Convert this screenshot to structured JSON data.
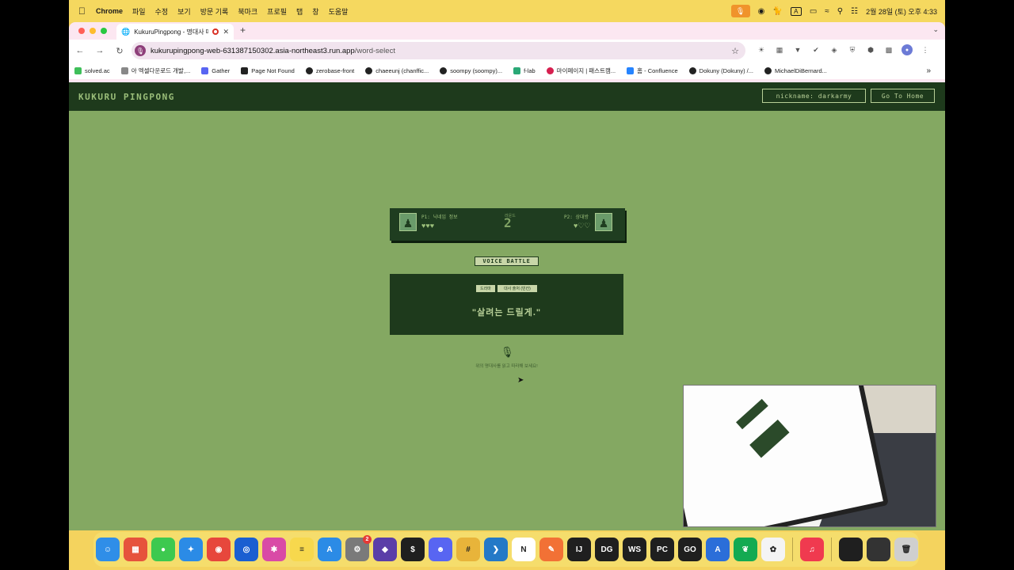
{
  "menubar": {
    "app_name": "Chrome",
    "menus": [
      "파일",
      "수정",
      "보기",
      "방문 기록",
      "북마크",
      "프로필",
      "탭",
      "창",
      "도움말"
    ],
    "input_indicator": "A",
    "clock": "2월 28일 (토) 오후 4:33"
  },
  "browser": {
    "tab_title": "KukuruPingpong - 명대사 따라하기",
    "url_host": "kukurupingpong-web-631387150302.asia-northeast3.run.app",
    "url_path": "/word-select",
    "bookmarks": [
      {
        "label": "solved.ac",
        "color": "#3fbf5a"
      },
      {
        "label": "아 엑셀다운로드 개발,...",
        "color": "#888888"
      },
      {
        "label": "Gather",
        "color": "#5865f2"
      },
      {
        "label": "Page Not Found",
        "color": "#222222"
      },
      {
        "label": "zerobase-front",
        "color": "#222222"
      },
      {
        "label": "chaeeunj (chanffic...",
        "color": "#222222"
      },
      {
        "label": "soompy (soompy)...",
        "color": "#222222"
      },
      {
        "label": "f-lab",
        "color": "#2aa876"
      },
      {
        "label": "마이페이지 | 패스트캠...",
        "color": "#d61f4f"
      },
      {
        "label": "홈 - Confluence",
        "color": "#2684ff"
      },
      {
        "label": "Dokuny (Dokuny) /...",
        "color": "#222222"
      },
      {
        "label": "MichaelDiBernard...",
        "color": "#222222"
      }
    ]
  },
  "site": {
    "logo": "KUKURU PINGPONG",
    "nickname_button": "nickname: darkarmy",
    "home_button": "Go To Home"
  },
  "game": {
    "p1": {
      "name": "P1: 닉네임 정보",
      "hearts": "♥♥♥",
      "lives": 3,
      "max_lives": 3
    },
    "p2": {
      "name": "P2: 상대방",
      "hearts": "♥♡♡",
      "lives": 1,
      "max_lives": 3
    },
    "round_label": "라운드",
    "round": "2",
    "mode": "VOICE BATTLE",
    "chip_1": "드라마",
    "chip_2": "대사 출처 (빈칸)",
    "quote": "\"살려는 드릴게.\"",
    "hint": "위의 명대사를 읽고 따라해 보세요!"
  },
  "colors": {
    "page_bg": "#84a862",
    "dark_green": "#1e3a1c",
    "light_green": "#b7cf97",
    "menubar_bg": "#f5d85f"
  },
  "dock": {
    "apps": [
      {
        "name": "Finder",
        "icon": "finder-icon",
        "glyph": "☺",
        "color": "#2f8ee8"
      },
      {
        "name": "Launchpad",
        "icon": "launchpad-icon",
        "glyph": "▦",
        "color": "#e6533c"
      },
      {
        "name": "Messages",
        "icon": "messages-icon",
        "glyph": "●",
        "color": "#3dc94f"
      },
      {
        "name": "Safari",
        "icon": "safari-icon",
        "glyph": "✦",
        "color": "#2b8be6"
      },
      {
        "name": "Chrome",
        "icon": "chrome-icon",
        "glyph": "◉",
        "color": "#e7473c"
      },
      {
        "name": "Firefox",
        "icon": "firefox-icon",
        "glyph": "◎",
        "color": "#1a5fd1"
      },
      {
        "name": "Affinity",
        "icon": "affinity-icon",
        "glyph": "✱",
        "color": "#d94aa6"
      },
      {
        "name": "Notes",
        "icon": "notes-icon",
        "glyph": "≡",
        "color": "#f7d84d"
      },
      {
        "name": "App Store",
        "icon": "app-store-icon",
        "glyph": "A",
        "color": "#2b8be6"
      },
      {
        "name": "System Settings",
        "icon": "settings-icon",
        "glyph": "⚙",
        "color": "#7a7a7a",
        "badge": "2"
      },
      {
        "name": "Obsidian",
        "icon": "obsidian-icon",
        "glyph": "◆",
        "color": "#5a3ea8"
      },
      {
        "name": "Terminal",
        "icon": "terminal-icon",
        "glyph": "$",
        "color": "#1f1f1f"
      },
      {
        "name": "Discord",
        "icon": "discord-icon",
        "glyph": "☻",
        "color": "#5865f2"
      },
      {
        "name": "Slack",
        "icon": "slack-icon",
        "glyph": "#",
        "color": "#e8b43a"
      },
      {
        "name": "VS Code",
        "icon": "vscode-icon",
        "glyph": "❯",
        "color": "#2479c7"
      },
      {
        "name": "Notion",
        "icon": "notion-icon",
        "glyph": "N",
        "color": "#ffffff"
      },
      {
        "name": "Pages",
        "icon": "pages-icon",
        "glyph": "✎",
        "color": "#f27135"
      },
      {
        "name": "IntelliJ",
        "icon": "intellij-icon",
        "glyph": "IJ",
        "color": "#1f1f1f"
      },
      {
        "name": "DataGrip",
        "icon": "datagrip-icon",
        "glyph": "DG",
        "color": "#1f1f1f"
      },
      {
        "name": "WebStorm",
        "icon": "webstorm-icon",
        "glyph": "WS",
        "color": "#1f1f1f"
      },
      {
        "name": "PyCharm",
        "icon": "pycharm-icon",
        "glyph": "PC",
        "color": "#1f1f1f"
      },
      {
        "name": "GoLand",
        "icon": "goland-icon",
        "glyph": "GO",
        "color": "#1f1f1f"
      },
      {
        "name": "Instruments",
        "icon": "instruments-icon",
        "glyph": "A",
        "color": "#2b6ed9"
      },
      {
        "name": "MongoDB Compass",
        "icon": "mongodb-icon",
        "glyph": "❦",
        "color": "#13aa52"
      },
      {
        "name": "ChatGPT",
        "icon": "chatgpt-icon",
        "glyph": "✿",
        "color": "#f4f4f4"
      },
      {
        "name": "Music",
        "icon": "music-icon",
        "glyph": "♫",
        "color": "#f03a4f"
      },
      {
        "name": "Window 1",
        "icon": "window-thumbnail-icon",
        "glyph": "",
        "color": "#1f1f1f"
      },
      {
        "name": "Window 2",
        "icon": "window-thumbnail-icon",
        "glyph": "",
        "color": "#333333"
      },
      {
        "name": "Trash",
        "icon": "trash-icon",
        "glyph": "🗑",
        "color": "#cfcfcf"
      }
    ]
  }
}
